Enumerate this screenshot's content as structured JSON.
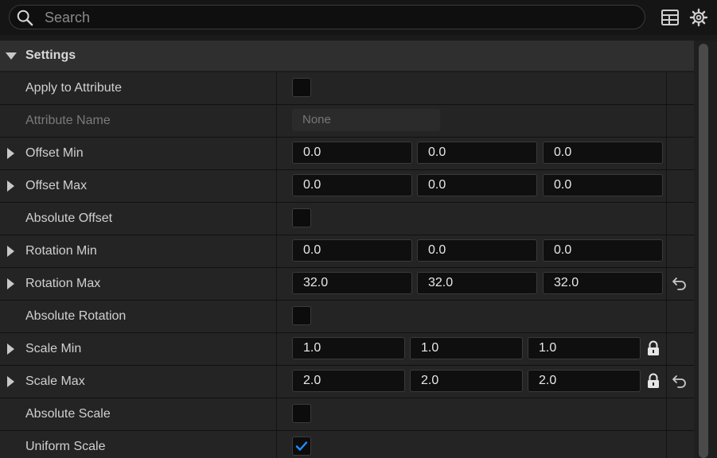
{
  "search": {
    "placeholder": "Search",
    "value": ""
  },
  "toolbar": {
    "icons": [
      "table-view-icon",
      "settings-gear-icon"
    ]
  },
  "section": {
    "title": "Settings",
    "expanded": true
  },
  "rows": [
    {
      "label": "Apply to Attribute",
      "type": "checkbox",
      "checked": false
    },
    {
      "label": "Attribute Name",
      "type": "combo",
      "value": "None",
      "disabled": true
    },
    {
      "label": "Offset Min",
      "type": "vector",
      "values": [
        "0.0",
        "0.0",
        "0.0"
      ]
    },
    {
      "label": "Offset Max",
      "type": "vector",
      "values": [
        "0.0",
        "0.0",
        "0.0"
      ]
    },
    {
      "label": "Absolute Offset",
      "type": "checkbox",
      "checked": false
    },
    {
      "label": "Rotation Min",
      "type": "vector",
      "values": [
        "0.0",
        "0.0",
        "0.0"
      ]
    },
    {
      "label": "Rotation Max",
      "type": "vector",
      "values": [
        "32.0",
        "32.0",
        "32.0"
      ],
      "reset": true
    },
    {
      "label": "Absolute Rotation",
      "type": "checkbox",
      "checked": false
    },
    {
      "label": "Scale Min",
      "type": "vector",
      "values": [
        "1.0",
        "1.0",
        "1.0"
      ],
      "lock": true
    },
    {
      "label": "Scale Max",
      "type": "vector",
      "values": [
        "2.0",
        "2.0",
        "2.0"
      ],
      "lock": true,
      "reset": true
    },
    {
      "label": "Absolute Scale",
      "type": "checkbox",
      "checked": false
    },
    {
      "label": "Uniform Scale",
      "type": "checkbox",
      "checked": true
    }
  ],
  "colors": {
    "accent": "#1e90ff",
    "background": "#1a1a1a",
    "row": "#242424",
    "header": "#2f2f2f"
  }
}
